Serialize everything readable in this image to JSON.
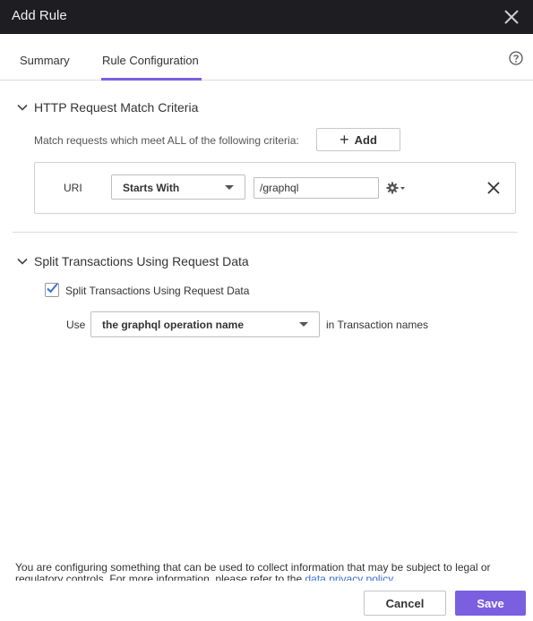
{
  "window": {
    "title": "Add Rule"
  },
  "tabs": [
    {
      "label": "Summary",
      "active": false
    },
    {
      "label": "Rule Configuration",
      "active": true
    }
  ],
  "http_section": {
    "heading": "HTTP Request Match Criteria",
    "match_text": "Match requests which meet ALL of the following criteria:",
    "add_label": "Add",
    "criteria": {
      "field_label": "URI",
      "operator": "Starts With",
      "value": "/graphql"
    }
  },
  "split_section": {
    "heading": "Split Transactions Using Request Data",
    "checkbox_label": "Split Transactions Using Request Data",
    "checked": true,
    "use_label": "Use",
    "use_value": "the graphql operation name",
    "suffix": "in Transaction names"
  },
  "footer": {
    "notice": "You are configuring something that can be used to collect information that may be subject to legal or regulatory controls. For more information, please refer to the",
    "link_text": "data privacy policy"
  },
  "actions": {
    "cancel": "Cancel",
    "save": "Save"
  },
  "colors": {
    "accent": "#7a60e0",
    "titlebar": "#1d1d22",
    "link": "#3a6fd8"
  },
  "icons": [
    "close-icon",
    "help-icon",
    "chevron-down-icon",
    "plus-icon",
    "gear-icon",
    "remove-icon",
    "check-icon"
  ]
}
